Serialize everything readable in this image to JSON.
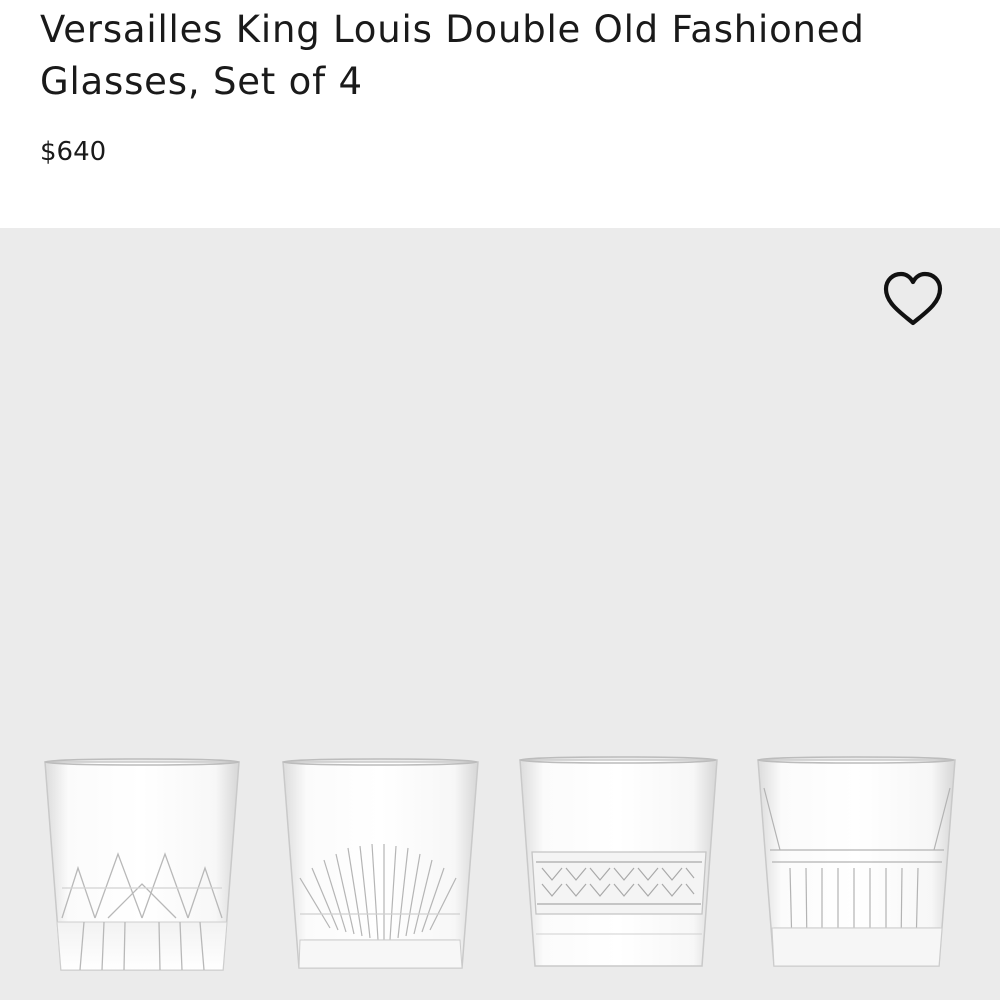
{
  "product": {
    "title": "Versailles King Louis Double Old Fashioned Glasses, Set of 4",
    "price": "$640"
  },
  "wishlist": {
    "icon": "heart-outline-icon"
  },
  "gallery": {
    "background": "#ebebeb",
    "image": "product-glasses-photo"
  }
}
